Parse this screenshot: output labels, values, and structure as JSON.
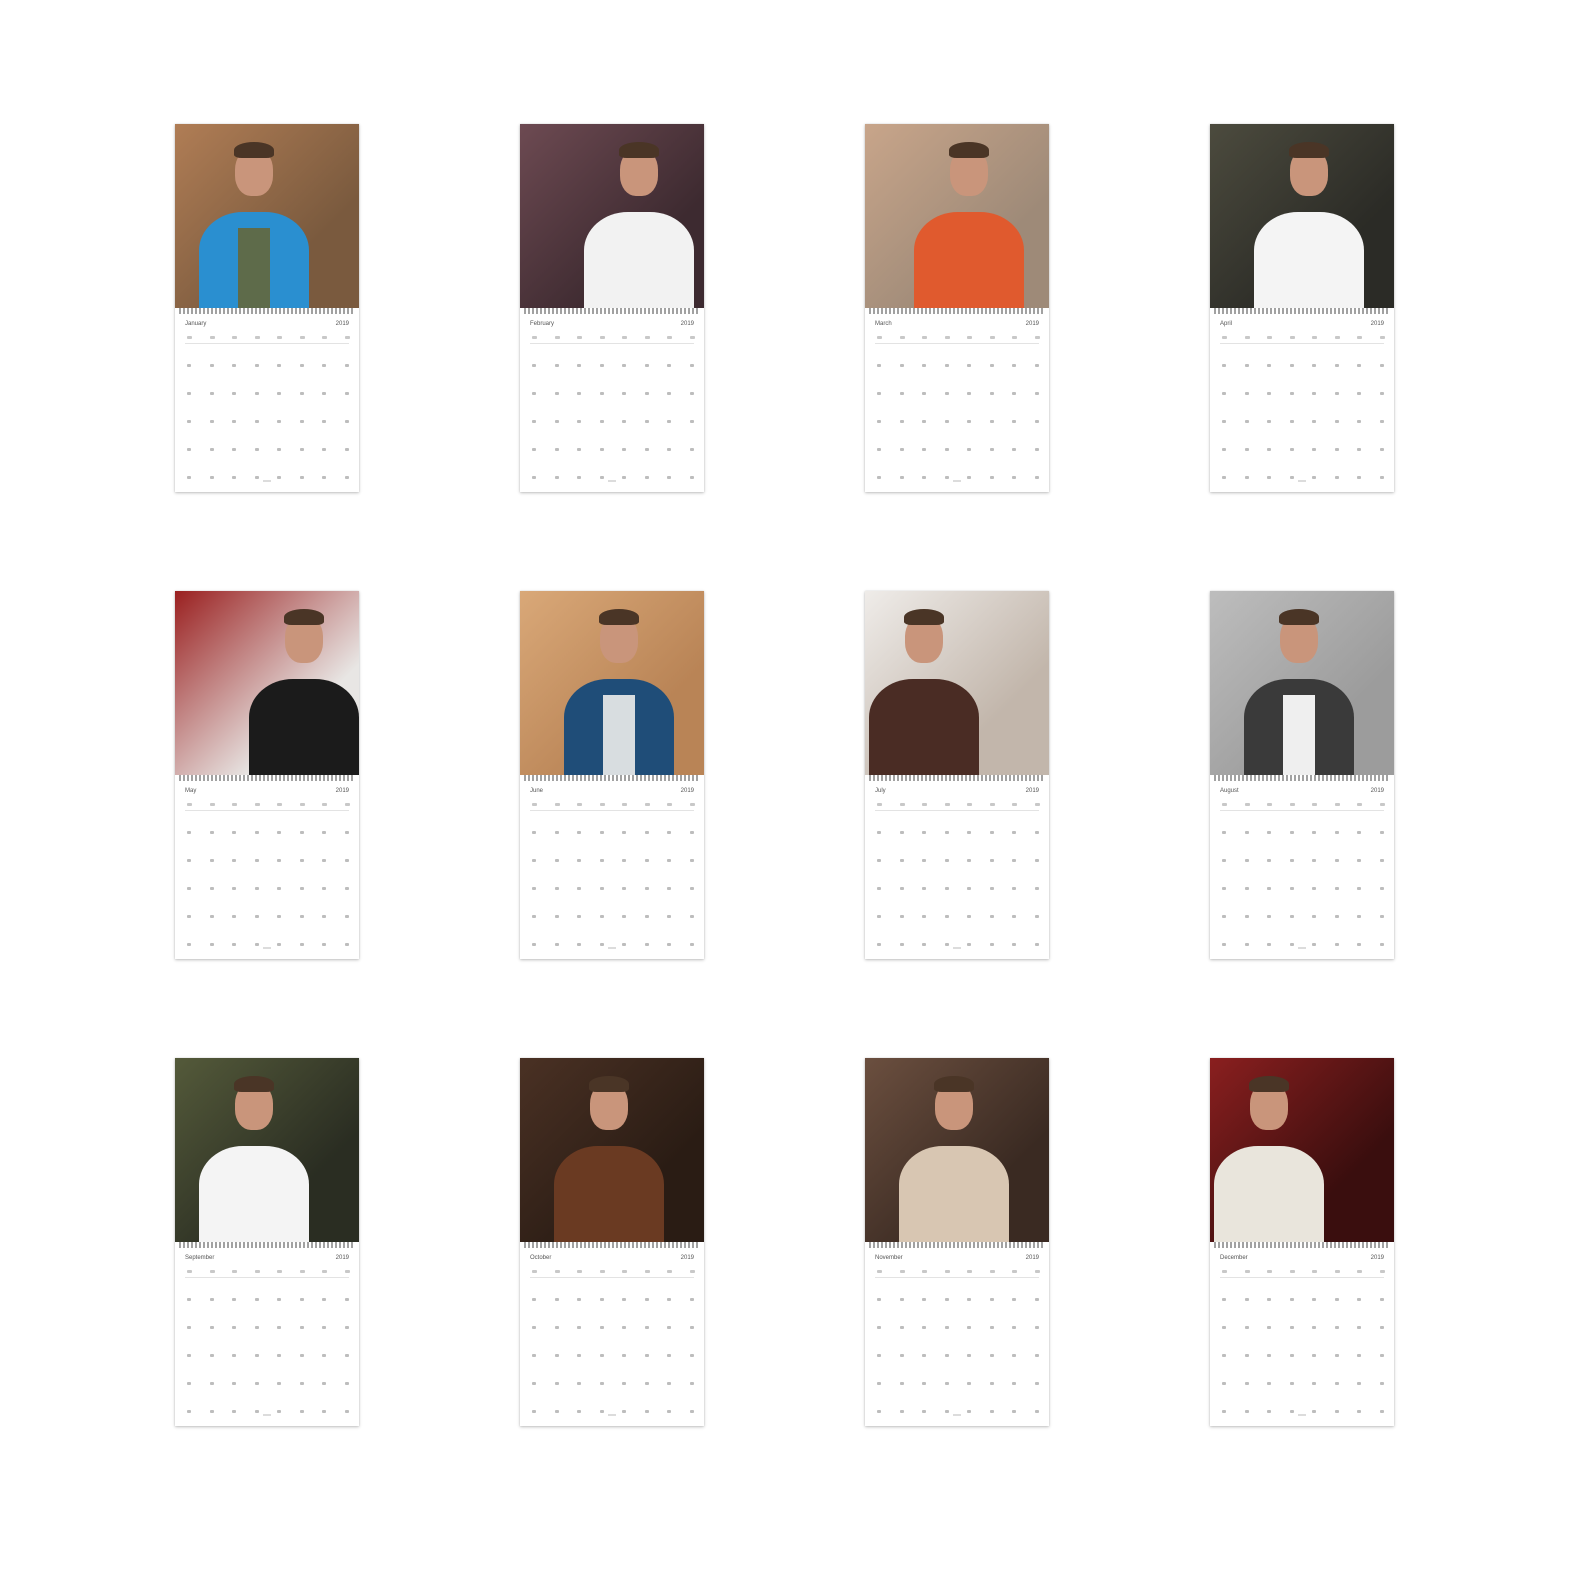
{
  "calendar": {
    "months": [
      {
        "name": "January",
        "year": "2019",
        "photo_colors": {
          "bg": "#7a5a3e",
          "bg2": "#b07d55",
          "body": "#2a8fd0",
          "shirt": "#5e6b4a"
        }
      },
      {
        "name": "February",
        "year": "2019",
        "photo_colors": {
          "bg": "#3d2a30",
          "bg2": "#6d4a52",
          "body": "#f2f2f2",
          "shirt": "#f2f2f2"
        }
      },
      {
        "name": "March",
        "year": "2019",
        "photo_colors": {
          "bg": "#9e8a78",
          "bg2": "#c8a58a",
          "body": "#e05a2e",
          "shirt": "#e05a2e"
        }
      },
      {
        "name": "April",
        "year": "2019",
        "photo_colors": {
          "bg": "#2b2b26",
          "bg2": "#4c4b3e",
          "body": "#f4f4f4",
          "shirt": "#f4f4f4"
        }
      },
      {
        "name": "May",
        "year": "2019",
        "photo_colors": {
          "bg": "#e8e6e4",
          "bg2": "#9a2020",
          "body": "#1b1b1b",
          "shirt": "#1b1b1b"
        }
      },
      {
        "name": "June",
        "year": "2019",
        "photo_colors": {
          "bg": "#b98456",
          "bg2": "#d9a878",
          "body": "#1f4d78",
          "shirt": "#d8dde0"
        }
      },
      {
        "name": "July",
        "year": "2019",
        "photo_colors": {
          "bg": "#c2b6ab",
          "bg2": "#efece9",
          "body": "#4a2c24",
          "shirt": "#4a2c24"
        }
      },
      {
        "name": "August",
        "year": "2019",
        "photo_colors": {
          "bg": "#9c9c9c",
          "bg2": "#bdbdbd",
          "body": "#3a3a3a",
          "shirt": "#efefef"
        }
      },
      {
        "name": "September",
        "year": "2019",
        "photo_colors": {
          "bg": "#2a2d22",
          "bg2": "#545a3a",
          "body": "#f4f4f4",
          "shirt": "#f4f4f4"
        }
      },
      {
        "name": "October",
        "year": "2019",
        "photo_colors": {
          "bg": "#2a1c14",
          "bg2": "#4a3124",
          "body": "#6a3a22",
          "shirt": "#6a3a22"
        }
      },
      {
        "name": "November",
        "year": "2019",
        "photo_colors": {
          "bg": "#3a2a22",
          "bg2": "#6b4f3f",
          "body": "#d8c6b2",
          "shirt": "#d8c6b2"
        }
      },
      {
        "name": "December",
        "year": "2019",
        "photo_colors": {
          "bg": "#3a0e0e",
          "bg2": "#8a1f1f",
          "body": "#e9e5dc",
          "shirt": "#e9e5dc"
        }
      }
    ]
  }
}
